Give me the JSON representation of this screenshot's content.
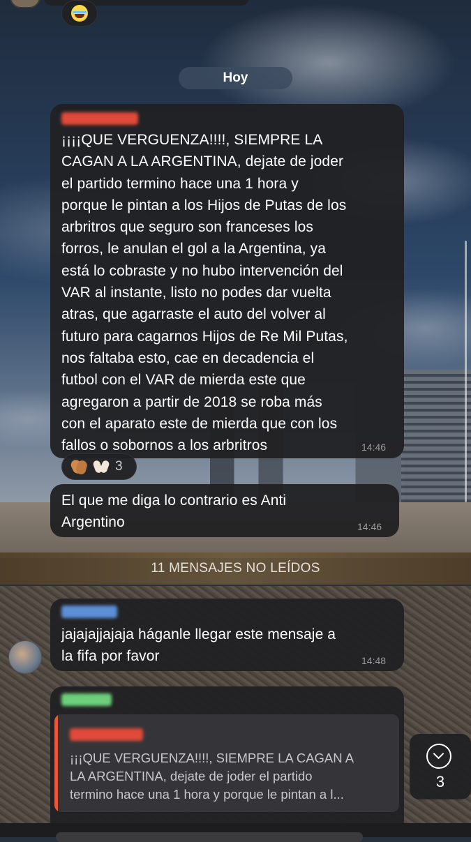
{
  "date_separator": "Hoy",
  "messages": [
    {
      "text": "¡¡¡¡QUE VERGUENZA!!!!, SIEMPRE LA CAGAN A LA ARGENTINA, dejate de joder el partido termino hace una 1 hora y porque le pintan a los Hijos de Putas de los arbritros que seguro son franceses los forros, le anulan el gol a la Argentina, ya está lo cobraste y no hubo intervención del VAR al instante, listo no podes dar vuelta atras, que agarraste el auto del volver al futuro para cagarnos Hijos de Re Mil Putas, nos faltaba esto, cae en decadencia el futbol con el VAR de mierda este que agregaron a partir de 2018 se roba más con el aparato este de mierda que con los fallos o sobornos a los arbritros",
      "lines": [
        "¡¡¡¡QUE VERGUENZA!!!!, SIEMPRE LA",
        "CAGAN A LA ARGENTINA, dejate de joder",
        "el partido termino hace una 1 hora y",
        "porque le pintan a los Hijos de Putas de los",
        "arbritros que seguro son franceses los",
        "forros, le anulan el gol a la Argentina, ya",
        "está lo cobraste y no hubo intervención del",
        "VAR al instante, listo no podes dar vuelta",
        "atras, que agarraste el auto del volver al",
        "futuro para cagarnos Hijos de Re Mil Putas,",
        "nos faltaba esto, cae en decadencia el",
        "futbol con el VAR de mierda este que",
        "agregaron a partir de 2018 se roba más",
        "con el aparato este de mierda que con los",
        "fallos o sobornos a los arbritros"
      ],
      "time": "14:46",
      "reaction_count": "3"
    },
    {
      "lines": [
        "El que me diga lo contrario es Anti",
        "Argentino"
      ],
      "time": "14:46"
    },
    {
      "lines": [
        "jajajajjajaja háganle llegar este mensaje a",
        "la fifa por favor"
      ],
      "time": "14:48"
    },
    {
      "quote_lines": [
        "¡¡¡QUE VERGUENZA!!!!, SIEMPRE LA CAGAN A",
        "LA ARGENTINA, dejate de joder el partido",
        "termino hace una 1 hora y porque le pintan a l..."
      ]
    }
  ],
  "unread_banner": "11 MENSAJES NO LEÍDOS",
  "scroll_button": {
    "count": "3"
  },
  "colors": {
    "bubble": "#212123",
    "accent_quote": "#e8593c",
    "sender_red": "#e04a3a",
    "sender_green": "#6dcf7a",
    "sender_blue": "#5b8fd6"
  }
}
